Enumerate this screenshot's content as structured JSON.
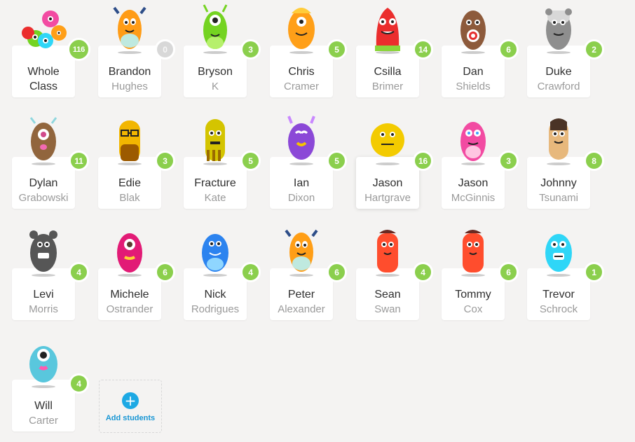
{
  "roster": {
    "whole_class": {
      "line1": "Whole",
      "line2": "Class",
      "points": "116",
      "avatar_icon": "group-monsters-icon"
    },
    "students": [
      {
        "first": "Brandon",
        "last": "Hughes",
        "points": "0",
        "avatar_icon": "monster-avatar-icon",
        "color": "#ff9c16"
      },
      {
        "first": "Bryson",
        "last": "K",
        "points": "3",
        "avatar_icon": "monster-avatar-icon",
        "color": "#74d321"
      },
      {
        "first": "Chris",
        "last": "Cramer",
        "points": "5",
        "avatar_icon": "monster-avatar-icon",
        "color": "#ff9f18"
      },
      {
        "first": "Csilla",
        "last": "Brimer",
        "points": "14",
        "avatar_icon": "monster-avatar-icon",
        "color": "#eb2d2d"
      },
      {
        "first": "Dan",
        "last": "Shields",
        "points": "6",
        "avatar_icon": "monster-avatar-icon",
        "color": "#8d5a3b"
      },
      {
        "first": "Duke",
        "last": "Crawford",
        "points": "2",
        "avatar_icon": "monster-avatar-icon",
        "color": "#8e8e8e"
      },
      {
        "first": "Dylan",
        "last": "Grabowski",
        "points": "11",
        "avatar_icon": "monster-avatar-icon",
        "color": "#91653d"
      },
      {
        "first": "Edie",
        "last": "Blak",
        "points": "3",
        "avatar_icon": "monster-avatar-icon",
        "color": "#f2b600"
      },
      {
        "first": "Fracture",
        "last": "Kate",
        "points": "5",
        "avatar_icon": "monster-avatar-icon",
        "color": "#d4c400"
      },
      {
        "first": "Ian",
        "last": "Dixon",
        "points": "5",
        "avatar_icon": "monster-avatar-icon",
        "color": "#8b48d7"
      },
      {
        "first": "Jason",
        "last": "Hartgrave",
        "points": "16",
        "avatar_icon": "monster-avatar-icon",
        "color": "#f3cb00"
      },
      {
        "first": "Jason",
        "last": "McGinnis",
        "points": "3",
        "avatar_icon": "monster-avatar-icon",
        "color": "#f24ba2"
      },
      {
        "first": "Johnny",
        "last": "Tsunami",
        "points": "8",
        "avatar_icon": "monster-avatar-icon",
        "color": "#e7b87c"
      },
      {
        "first": "Levi",
        "last": "Morris",
        "points": "4",
        "avatar_icon": "monster-avatar-icon",
        "color": "#565656"
      },
      {
        "first": "Michele",
        "last": "Ostrander",
        "points": "6",
        "avatar_icon": "monster-avatar-icon",
        "color": "#e21b76"
      },
      {
        "first": "Nick",
        "last": "Rodrigues",
        "points": "4",
        "avatar_icon": "monster-avatar-icon",
        "color": "#2c83ef"
      },
      {
        "first": "Peter",
        "last": "Alexander",
        "points": "6",
        "avatar_icon": "monster-avatar-icon",
        "color": "#ff9e16"
      },
      {
        "first": "Sean",
        "last": "Swan",
        "points": "4",
        "avatar_icon": "monster-avatar-icon",
        "color": "#ff4d2d"
      },
      {
        "first": "Tommy",
        "last": "Cox",
        "points": "6",
        "avatar_icon": "monster-avatar-icon",
        "color": "#ff4d2d"
      },
      {
        "first": "Trevor",
        "last": "Schrock",
        "points": "1",
        "avatar_icon": "monster-avatar-icon",
        "color": "#2fd6f7"
      },
      {
        "first": "Will",
        "last": "Carter",
        "points": "4",
        "avatar_icon": "monster-avatar-icon",
        "color": "#59c7dd"
      }
    ],
    "add_student": {
      "label": "Add students",
      "icon": "plus-icon"
    },
    "colors": {
      "background": "#f4f3f2",
      "badge": "#8bcf4d",
      "badge_zero": "#d8d8d8",
      "accent": "#1da9e4"
    }
  }
}
